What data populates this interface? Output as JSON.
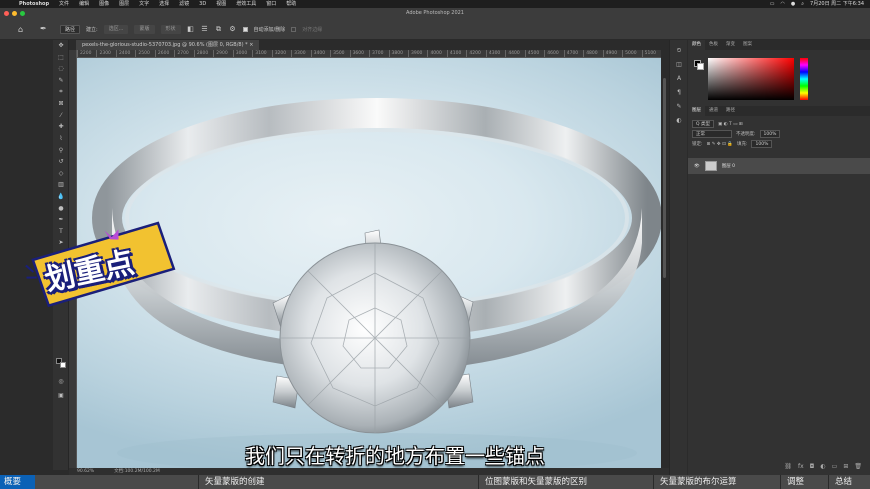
{
  "menubar": {
    "app": "Photoshop",
    "items": [
      "文件",
      "编辑",
      "图像",
      "图层",
      "文字",
      "选择",
      "滤镜",
      "3D",
      "视图",
      "增效工具",
      "窗口",
      "帮助"
    ],
    "clock": "7月20日 周二 下午6:34"
  },
  "window": {
    "title": "Adobe Photoshop 2021"
  },
  "options": {
    "mode": "路径",
    "make_label": "建立:",
    "selection_btn": "选区...",
    "mask_btn": "蒙版",
    "shape_btn": "形状",
    "auto_add_delete": "自动添加/删除",
    "align_edges": "对齐边缘"
  },
  "document": {
    "tab_title": "pexels-the-glorious-studio-5370703.jpg @ 90.6% (图层 0, RGB/8) *",
    "ruler_ticks": [
      "2200",
      "2300",
      "2400",
      "2500",
      "2600",
      "2700",
      "2800",
      "2900",
      "3000",
      "3100",
      "3200",
      "3300",
      "3400",
      "3500",
      "3600",
      "3700",
      "3800",
      "3900",
      "4000",
      "4100",
      "4200",
      "4300",
      "4400",
      "4500",
      "4600",
      "4700",
      "4800",
      "4900",
      "5000",
      "5100"
    ],
    "zoom": "90.62%",
    "doc_size": "文档:100.2M/100.2M"
  },
  "panels": {
    "color_tabs": [
      "颜色",
      "色板",
      "渐变",
      "图案"
    ],
    "layer_tabs": [
      "图层",
      "通道",
      "路径"
    ],
    "kind_filter": "Q 类型",
    "blend_mode": "正常",
    "opacity_label": "不透明度:",
    "opacity_value": "100%",
    "lock_label": "锁定:",
    "fill_label": "填充:",
    "fill_value": "100%",
    "layer_name": "图层 0",
    "foreground_color": "#000000",
    "background_color": "#ffffff",
    "picker_hue": "#ff0000"
  },
  "sticker": {
    "text": "划重点"
  },
  "subtitle": "我们只在转折的地方布置一些锚点",
  "chapters": [
    {
      "label": "概要",
      "active": true
    },
    {
      "label": "矢量蒙版的创建",
      "active": false
    },
    {
      "label": "位图蒙版和矢量蒙版的区别",
      "active": false
    },
    {
      "label": "矢量蒙版的布尔运算",
      "active": false
    },
    {
      "label": "调整",
      "active": false
    },
    {
      "label": "总结",
      "active": false
    }
  ],
  "colors": {
    "chapter_active": "#0b61b6",
    "sticker_outline": "#1a1f7a",
    "sticker_bg": "#f2c230"
  }
}
